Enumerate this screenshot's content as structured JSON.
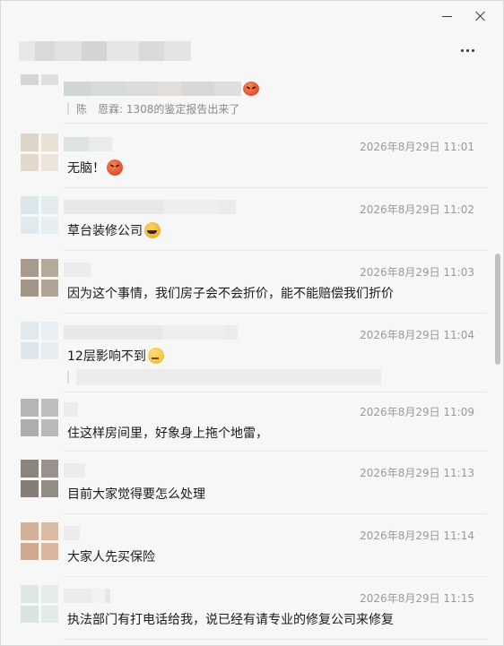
{
  "window": {
    "minimize_icon": "minimize-icon",
    "close_icon": "close-icon",
    "more_icon": "more-icon"
  },
  "messages": [
    {
      "time": "",
      "text": "",
      "quote": "陈　恩霖: 1308的鉴定报告出来了",
      "emoji": "angry-face-icon"
    },
    {
      "time": "2026年8月29日 11:01",
      "text": "无脑！",
      "emoji": "angry-face-icon"
    },
    {
      "time": "2026年8月29日 11:02",
      "text": "草台装修公司",
      "emoji": "pick-nose-icon"
    },
    {
      "time": "2026年8月29日 11:03",
      "text": "因为这个事情，我们房子会不会折价，能不能赔偿我们折价"
    },
    {
      "time": "2026年8月29日 11:04",
      "text": "12层影响不到",
      "emoji": "thinking-face-icon"
    },
    {
      "time": "2026年8月29日 11:09",
      "text": "住这样房间里，好象身上拖个地雷，"
    },
    {
      "time": "2026年8月29日 11:13",
      "text": "目前大家觉得要怎么处理"
    },
    {
      "time": "2026年8月29日 11:14",
      "text": "大家人先买保险"
    },
    {
      "time": "2026年8月29日 11:15",
      "text": "执法部门有打电话给我，说已经有请专业的修复公司来修复"
    }
  ]
}
